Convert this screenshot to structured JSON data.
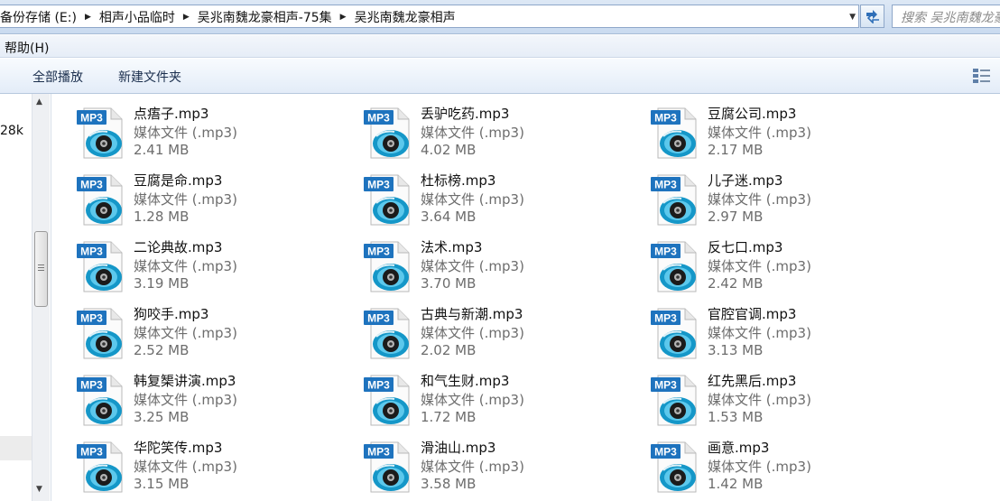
{
  "address": {
    "crumbs": [
      "备份存储 (E:)",
      "相声小品临时",
      "吴兆南魏龙豪相声-75集",
      "吴兆南魏龙豪相声"
    ],
    "search_placeholder": "搜索 吴兆南魏龙豪相声"
  },
  "menu": {
    "help": "帮助(H)"
  },
  "toolbar": {
    "play_all": "全部播放",
    "new_folder": "新建文件夹"
  },
  "nav": {
    "fragment": "28k"
  },
  "colors": {
    "accent": "#2aa6d6",
    "badge": "#1e73be"
  },
  "icons": {
    "file": "mp3-file-icon",
    "refresh": "refresh-icon",
    "view": "view-options-icon"
  },
  "files": [
    {
      "name": "点痦子.mp3",
      "type": "媒体文件 (.mp3)",
      "size": "2.41 MB"
    },
    {
      "name": "丢驴吃药.mp3",
      "type": "媒体文件 (.mp3)",
      "size": "4.02 MB"
    },
    {
      "name": "豆腐公司.mp3",
      "type": "媒体文件 (.mp3)",
      "size": "2.17 MB"
    },
    {
      "name": "豆腐是命.mp3",
      "type": "媒体文件 (.mp3)",
      "size": "1.28 MB"
    },
    {
      "name": "杜标榜.mp3",
      "type": "媒体文件 (.mp3)",
      "size": "3.64 MB"
    },
    {
      "name": "儿子迷.mp3",
      "type": "媒体文件 (.mp3)",
      "size": "2.97 MB"
    },
    {
      "name": "二论典故.mp3",
      "type": "媒体文件 (.mp3)",
      "size": "3.19 MB"
    },
    {
      "name": "法术.mp3",
      "type": "媒体文件 (.mp3)",
      "size": "3.70 MB"
    },
    {
      "name": "反七口.mp3",
      "type": "媒体文件 (.mp3)",
      "size": "2.42 MB"
    },
    {
      "name": "狗咬手.mp3",
      "type": "媒体文件 (.mp3)",
      "size": "2.52 MB"
    },
    {
      "name": "古典与新潮.mp3",
      "type": "媒体文件 (.mp3)",
      "size": "2.02 MB"
    },
    {
      "name": "官腔官调.mp3",
      "type": "媒体文件 (.mp3)",
      "size": "3.13 MB"
    },
    {
      "name": "韩复榘讲演.mp3",
      "type": "媒体文件 (.mp3)",
      "size": "3.25 MB"
    },
    {
      "name": "和气生财.mp3",
      "type": "媒体文件 (.mp3)",
      "size": "1.72 MB"
    },
    {
      "name": "红先黑后.mp3",
      "type": "媒体文件 (.mp3)",
      "size": "1.53 MB"
    },
    {
      "name": "华陀笑传.mp3",
      "type": "媒体文件 (.mp3)",
      "size": "3.15 MB"
    },
    {
      "name": "滑油山.mp3",
      "type": "媒体文件 (.mp3)",
      "size": "3.58 MB"
    },
    {
      "name": "画意.mp3",
      "type": "媒体文件 (.mp3)",
      "size": "1.42 MB"
    }
  ],
  "file_badge": "MP3"
}
